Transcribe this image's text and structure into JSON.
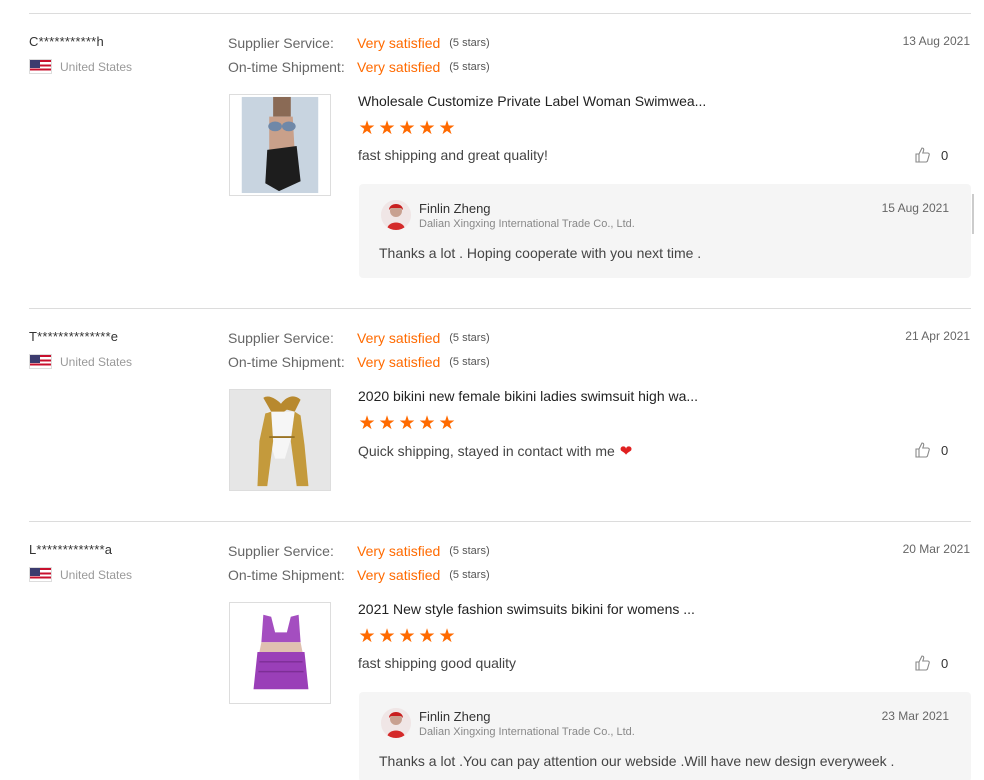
{
  "reviews": [
    {
      "username": "C***********h",
      "country": "United States",
      "supplier_service_label": "Supplier Service:",
      "supplier_service_value": "Very satisfied",
      "supplier_service_stars": "(5 stars)",
      "shipment_label": "On-time Shipment:",
      "shipment_value": "Very satisfied",
      "shipment_stars": "(5 stars)",
      "date": "13 Aug 2021",
      "product_title": "Wholesale Customize Private Label Woman Swimwea...",
      "rating": 5,
      "comment": "fast shipping and great quality!",
      "likes": "0",
      "reply": {
        "name": "Finlin Zheng",
        "company": "Dalian Xingxing International Trade Co., Ltd.",
        "date": "15 Aug 2021",
        "text": "Thanks a lot . Hoping cooperate with you next time ."
      }
    },
    {
      "username": "T**************e",
      "country": "United States",
      "supplier_service_label": "Supplier Service:",
      "supplier_service_value": "Very satisfied",
      "supplier_service_stars": "(5 stars)",
      "shipment_label": "On-time Shipment:",
      "shipment_value": "Very satisfied",
      "shipment_stars": "(5 stars)",
      "date": "21 Apr 2021",
      "product_title": "2020 bikini new female bikini ladies swimsuit high wa...",
      "rating": 5,
      "comment": "Quick shipping, stayed in contact with me",
      "comment_emoji": "heart-icon",
      "likes": "0"
    },
    {
      "username": "L*************a",
      "country": "United States",
      "supplier_service_label": "Supplier Service:",
      "supplier_service_value": "Very satisfied",
      "supplier_service_stars": "(5 stars)",
      "shipment_label": "On-time Shipment:",
      "shipment_value": "Very satisfied",
      "shipment_stars": "(5 stars)",
      "date": "20 Mar 2021",
      "product_title": "2021 New style fashion swimsuits bikini for womens ...",
      "rating": 5,
      "comment": "fast shipping good quality",
      "likes": "0",
      "reply": {
        "name": "Finlin Zheng",
        "company": "Dalian Xingxing International Trade Co., Ltd.",
        "date": "23 Mar 2021",
        "text": "Thanks a lot .You can pay attention our webside .Will have new design everyweek ."
      }
    }
  ],
  "colors": {
    "accent": "#ff6a00",
    "heart": "#e02020"
  }
}
